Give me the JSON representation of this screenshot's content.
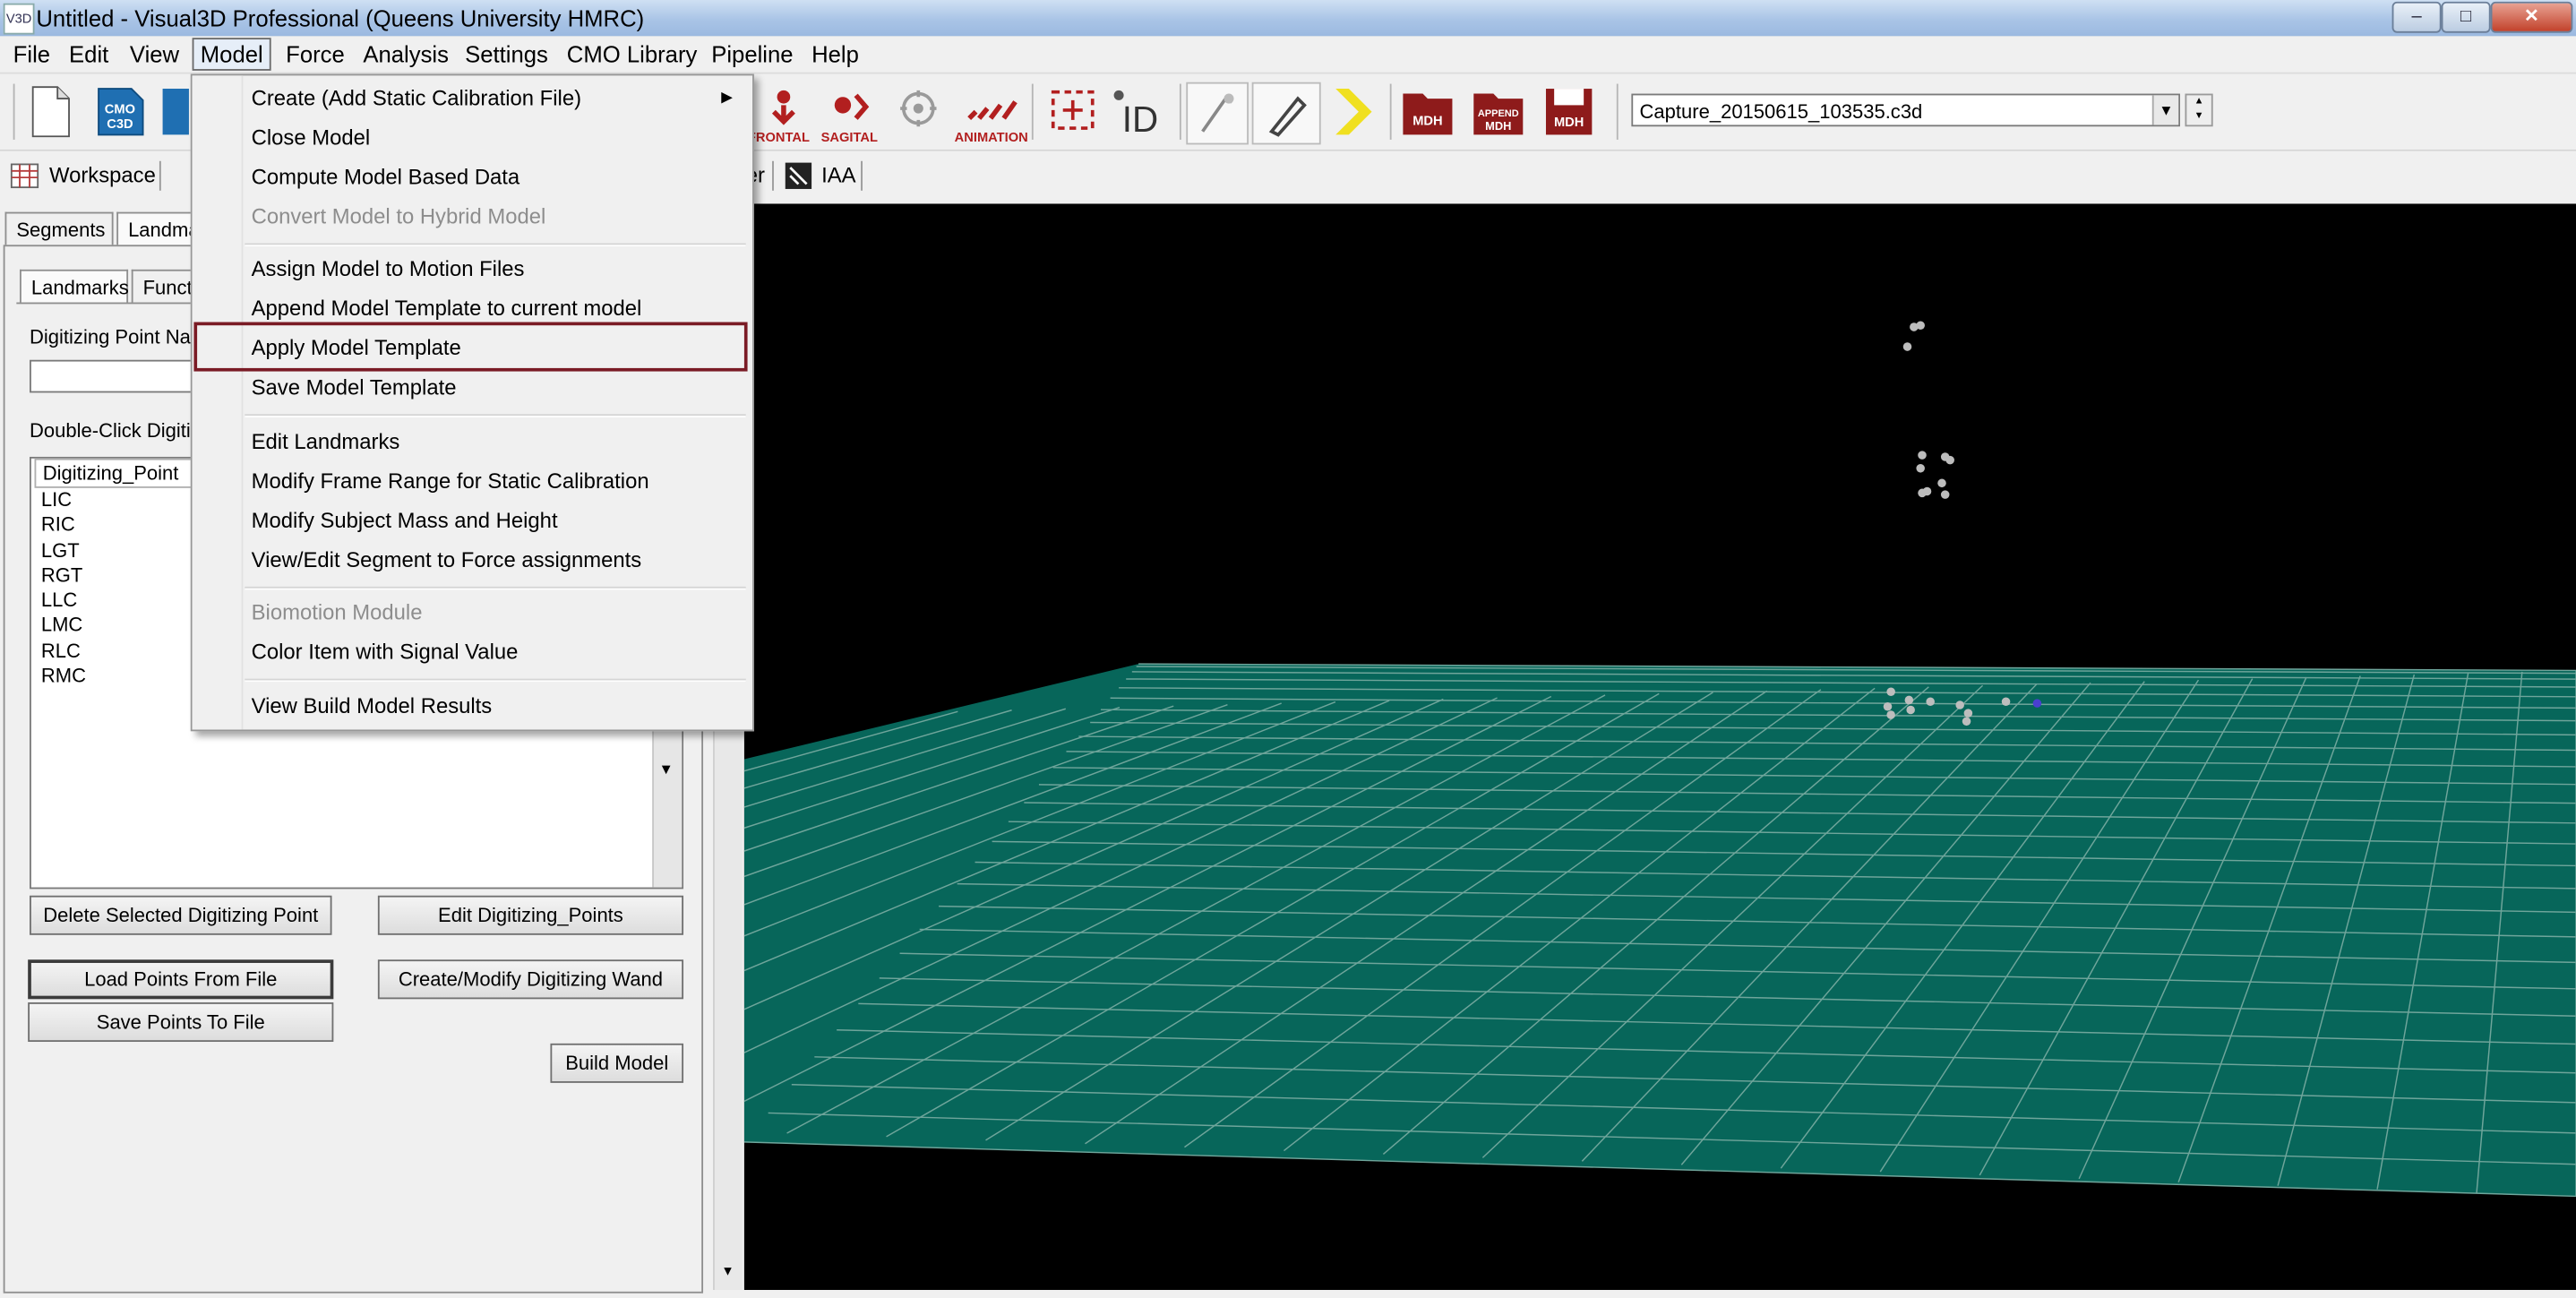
{
  "window": {
    "title": "Untitled - Visual3D Professional (Queens University HMRC)",
    "icon_text": "V3D",
    "controls": {
      "minimize": "–",
      "maximize": "□",
      "close": "✕"
    }
  },
  "menubar": {
    "items": [
      "File",
      "Edit",
      "View",
      "Model",
      "Force",
      "Analysis",
      "Settings",
      "CMO Library",
      "Pipeline",
      "Help"
    ],
    "active": "Model"
  },
  "toolbar": {
    "buttons": [
      {
        "name": "new-file-icon",
        "label": ""
      },
      {
        "name": "cmo-c3d-icon",
        "label": "CMO C3D"
      },
      {
        "name": "frontal-view-icon",
        "label": "FRONTAL"
      },
      {
        "name": "sagital-view-icon",
        "label": "SAGITAL"
      },
      {
        "name": "animation-view-icon",
        "label": "ANIMATION"
      },
      {
        "name": "reset-camera-icon",
        "label": "RESET CAMERA"
      },
      {
        "name": "id-icon",
        "label": "ID"
      },
      {
        "name": "digitize-wand-icon",
        "label": ""
      },
      {
        "name": "pointer-wand-icon",
        "label": ""
      },
      {
        "name": "next-chevron-icon",
        "label": ""
      },
      {
        "name": "open-mdh-icon",
        "label": "MDH"
      },
      {
        "name": "append-mdh-icon",
        "label": "APPEND MDH"
      },
      {
        "name": "save-mdh-icon",
        "label": "MDH"
      }
    ],
    "capture_file": "Capture_20150615_103535.c3d"
  },
  "toolbar2": {
    "workspace": "Workspace",
    "partial_label": "er",
    "iaa": "IAA"
  },
  "left_panel": {
    "top_tabs": [
      "Segments",
      "Landmarks"
    ],
    "sub_tabs": [
      "Landmarks",
      "Functional"
    ],
    "digitizing_point_label": "Digitizing Point Name",
    "double_click_label": "Double-Click Digitizing Point",
    "list_header": "Digitizing_Point",
    "points": [
      "LIC",
      "RIC",
      "LGT",
      "RGT",
      "LLC",
      "LMC",
      "RLC",
      "RMC"
    ],
    "buttons": {
      "delete": "Delete Selected Digitizing Point",
      "edit": "Edit Digitizing_Points",
      "load": "Load Points From File",
      "wand": "Create/Modify Digitizing Wand",
      "save": "Save Points To File",
      "build": "Build Model"
    }
  },
  "model_menu": {
    "items": [
      {
        "label": "Create (Add Static Calibration File)",
        "disabled": false,
        "submenu": true
      },
      {
        "label": "Close Model",
        "disabled": false
      },
      {
        "label": "Compute Model Based Data",
        "disabled": false
      },
      {
        "label": "Convert Model to Hybrid Model",
        "disabled": true
      },
      {
        "label": "Assign Model to Motion Files",
        "disabled": false
      },
      {
        "label": "Append Model Template to current model",
        "disabled": false
      },
      {
        "label": "Apply Model Template",
        "disabled": false,
        "highlighted": true
      },
      {
        "label": "Save Model Template",
        "disabled": false
      },
      {
        "label": "Edit Landmarks",
        "disabled": false
      },
      {
        "label": "Modify Frame Range for Static Calibration",
        "disabled": false
      },
      {
        "label": "Modify Subject Mass and Height",
        "disabled": false
      },
      {
        "label": "View/Edit Segment to Force assignments",
        "disabled": false
      },
      {
        "label": "Biomotion Module",
        "disabled": true
      },
      {
        "label": "Color Item with Signal Value",
        "disabled": false
      },
      {
        "label": "View Build Model Results",
        "disabled": false
      }
    ]
  },
  "colors": {
    "floor": "#07665a",
    "viewport_bg": "#000000",
    "highlight_border": "#7a1b25"
  }
}
